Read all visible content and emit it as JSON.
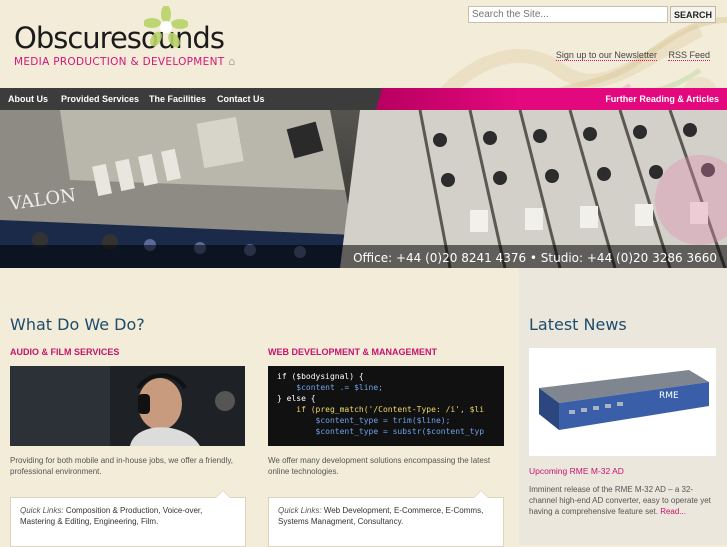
{
  "header": {
    "logo_name": "Obscuresounds",
    "logo_tagline": "MEDIA PRODUCTION & DEVELOPMENT",
    "search_placeholder": "Search the Site...",
    "search_button": "SEARCH",
    "newsletter_link": "Sign up to our Newsletter",
    "rss_link": "RSS Feed"
  },
  "nav": {
    "items": [
      "About Us",
      "Provided Services",
      "The Facilities",
      "Contact Us"
    ],
    "right_link": "Further Reading & Articles"
  },
  "banner": {
    "phone_text": "Office: +44 (0)20 8241 4376 • Studio: +44 (0)20 3286 3660"
  },
  "main": {
    "title": "What Do We Do?",
    "audio": {
      "heading": "AUDIO & FILM SERVICES",
      "text": "Providing for both mobile and in-house jobs, we offer a friendly, professional environment.",
      "quick_label": "Quick Links:",
      "links": [
        "Composition & Production",
        "Voice-over",
        "Mastering & Editing",
        "Engineering",
        "Film."
      ]
    },
    "web": {
      "heading": "WEB DEVELOPMENT & MANAGEMENT",
      "text": "We offer many development solutions encompassing the latest online technologies.",
      "code_lines": [
        "if ($bodysignal) {",
        "    $content .= $line;",
        "} else {",
        "    if (preg_match('/Content-Type: /i', $li",
        "        $content_type = trim($line);",
        "        $content_type = substr($content_typ"
      ],
      "quick_label": "Quick Links:",
      "links": [
        "Web Development",
        "E-Commerce",
        "E-Comms",
        "Systems Managment",
        "Consultancy."
      ]
    }
  },
  "news": {
    "title": "Latest News",
    "headline": "Upcoming RME M-32 AD",
    "text": "Imminent release of the RME M-32 AD – a 32-channel high-end AD converter, easy to operate yet having a comprehensive feature set.",
    "read_more": "Read...",
    "device_brand": "RME"
  },
  "colors": {
    "accent_pink": "#d4157a",
    "nav_dark": "#3c3c3c",
    "title_blue": "#1d4c6c",
    "background": "#f3ecd8"
  }
}
